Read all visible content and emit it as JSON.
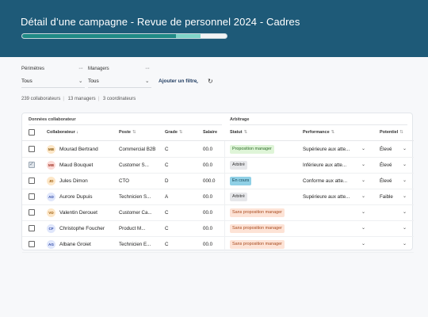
{
  "header": {
    "title": "Détail d’une campagne - Revue de personnel 2024 - Cadres",
    "progress": {
      "done": 0.75,
      "in_progress": 0.12
    },
    "colors": {
      "background": "#1e5a78",
      "done": "#1f8a85",
      "in_progress": "#7fd4c8"
    }
  },
  "filters": {
    "perimeters": {
      "label": "Périmètres",
      "value": "Tous",
      "menu_icon": "more-icon",
      "chevron_icon": "chevron-down-icon"
    },
    "managers": {
      "label": "Managers",
      "value": "Tous",
      "menu_icon": "more-icon",
      "chevron_icon": "chevron-down-icon"
    },
    "add_filter": "Ajouter un filtre",
    "reset_icon": "reset-icon"
  },
  "stats": {
    "collaborators": "239 collaborateurs",
    "managers": "13 managers",
    "coordinators": "3 coordinateurs"
  },
  "table": {
    "groups": {
      "employee_data": "Données collaborateur",
      "arbitration": "Arbitrage"
    },
    "columns": {
      "collaborator": "Collaborateur",
      "position": "Poste",
      "grade": "Grade",
      "salary": "Salaire",
      "status": "Statut",
      "performance": "Performance",
      "potential": "Potentiel"
    },
    "rows": [
      {
        "checked": false,
        "initials": "MB",
        "avatar_bg": "#fde7c8",
        "avatar_fg": "#8a5a10",
        "name": "Mourad Bertrand",
        "position": "Commercial B2B",
        "grade": "C",
        "salary": "00.0",
        "status": "Proposition manager",
        "status_bg": "#dff5d8",
        "status_fg": "#2f6e2a",
        "performance": "Supérieure aux atte...",
        "potential": "Élevé"
      },
      {
        "checked": true,
        "initials": "MB",
        "avatar_bg": "#fbd9d5",
        "avatar_fg": "#a3362a",
        "name": "Maud Bouquet",
        "position": "Customer S...",
        "grade": "C",
        "salary": "00.0",
        "status": "Arbitré",
        "status_bg": "#e6e7ea",
        "status_fg": "#333333",
        "performance": "Inférieure aux atte...",
        "potential": "Élevé"
      },
      {
        "checked": false,
        "initials": "JD",
        "avatar_bg": "#fde7c8",
        "avatar_fg": "#a0600f",
        "name": "Jules Dimon",
        "position": "CTO",
        "grade": "D",
        "salary": "000.0",
        "status": "En cours",
        "status_bg": "#8fd0e6",
        "status_fg": "#0f3d4f",
        "performance": "Conforme aux atte...",
        "potential": "Élevé"
      },
      {
        "checked": false,
        "initials": "AD",
        "avatar_bg": "#dfe6fb",
        "avatar_fg": "#2f4aa8",
        "name": "Aurore Dupuis",
        "position": "Technicien S...",
        "grade": "A",
        "salary": "00.0",
        "status": "Arbitré",
        "status_bg": "#e6e7ea",
        "status_fg": "#333333",
        "performance": "Supérieure aux atte...",
        "potential": "Faible"
      },
      {
        "checked": false,
        "initials": "VD",
        "avatar_bg": "#fde7c8",
        "avatar_fg": "#a0600f",
        "name": "Valentin Derouet",
        "position": "Customer Ca...",
        "grade": "C",
        "salary": "00.0",
        "status": "Sans proposition manager",
        "status_bg": "#fde3d6",
        "status_fg": "#a84a1e",
        "performance": "",
        "potential": ""
      },
      {
        "checked": false,
        "initials": "CF",
        "avatar_bg": "#dfe6fb",
        "avatar_fg": "#2f4aa8",
        "name": "Christophe Foucher",
        "position": "Product M...",
        "grade": "C",
        "salary": "00.0",
        "status": "Sans proposition manager",
        "status_bg": "#fde3d6",
        "status_fg": "#a84a1e",
        "performance": "",
        "potential": ""
      },
      {
        "checked": false,
        "initials": "AG",
        "avatar_bg": "#dfe6fb",
        "avatar_fg": "#2f4aa8",
        "name": "Albane Groiet",
        "position": "Technicien E...",
        "grade": "C",
        "salary": "00.0",
        "status": "Sans proposition manager",
        "status_bg": "#fde3d6",
        "status_fg": "#a84a1e",
        "performance": "",
        "potential": ""
      }
    ]
  }
}
